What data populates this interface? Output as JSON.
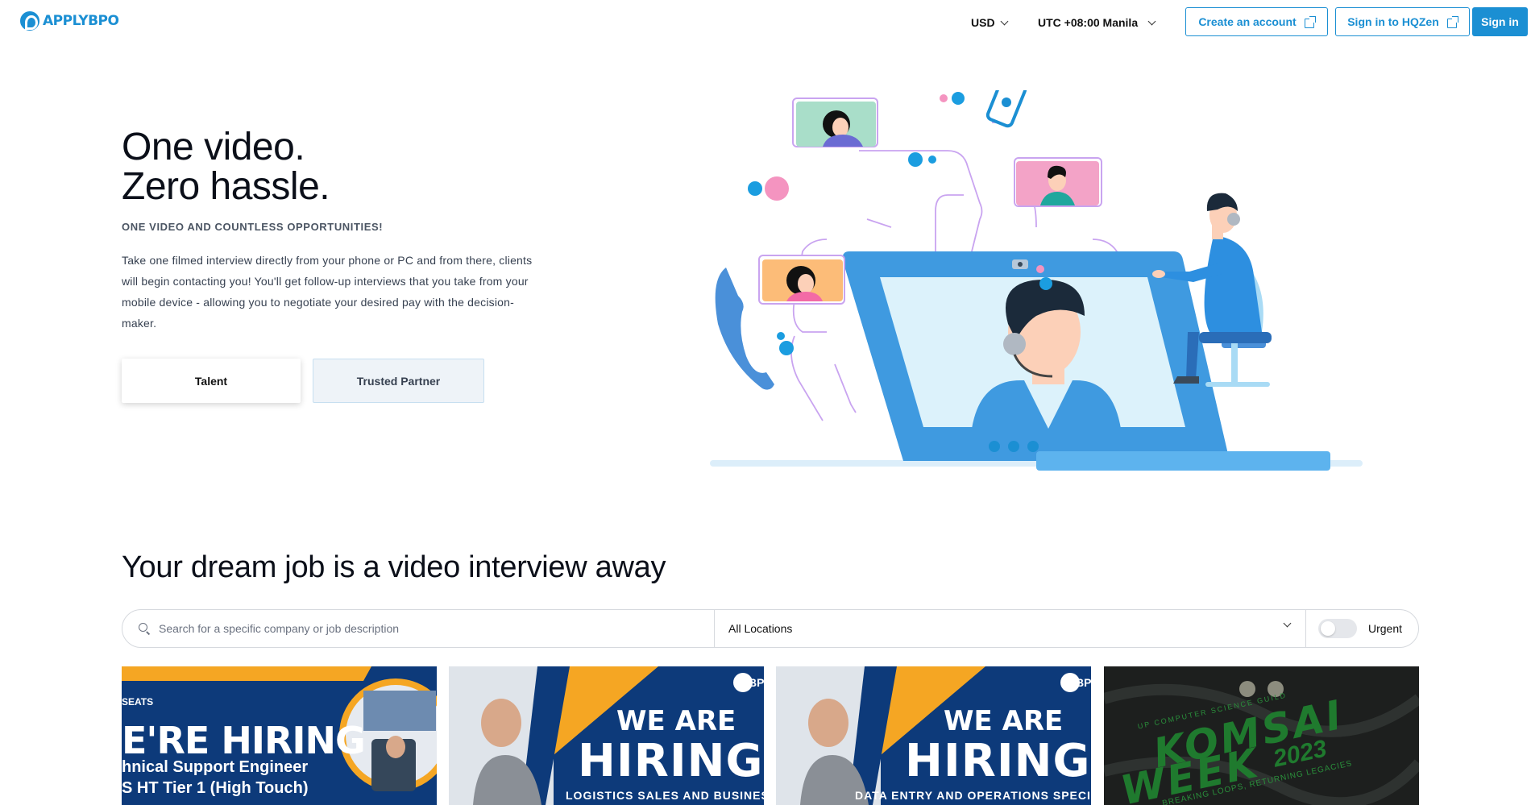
{
  "header": {
    "logo_text": "APPLYBPO",
    "currency": "USD",
    "timezone": "UTC +08:00 Manila",
    "create_account": "Create an account",
    "sign_in_hqzen": "Sign in to HQZen",
    "sign_in": "Sign in"
  },
  "hero": {
    "title_line1": "One video.",
    "title_line2": "Zero hassle.",
    "subtitle": "ONE VIDEO AND COUNTLESS OPPORTUNITIES!",
    "description": "Take one filmed interview directly from your phone or PC and from there, clients will begin contacting you! You'll get follow-up interviews that you take from your mobile device - allowing you to negotiate your desired pay with the decision-maker.",
    "talent_label": "Talent",
    "partner_label": "Trusted Partner"
  },
  "jobs": {
    "title": "Your dream job is a video interview away",
    "search_placeholder": "Search for a specific company or job description",
    "location": "All Locations",
    "urgent_label": "Urgent",
    "urgent_on": false,
    "cards": [
      {
        "tag": "SEATS",
        "headline": "E'RE HIRING",
        "line1": "hnical Support Engineer",
        "line2": "S HT Tier 1 (High Touch)"
      },
      {
        "tag": "BP",
        "headline_top": "WE ARE",
        "headline_big": "HIRING",
        "role": "LOGISTICS SALES AND BUSINES"
      },
      {
        "tag": "BP",
        "headline_top": "WE ARE",
        "headline_big": "HIRING",
        "role": "DATA ENTRY AND OPERATIONS SPECI"
      },
      {
        "headline": "KOMSAI",
        "headline2": "WEEK",
        "year": "2023",
        "top": "UP COMPUTER SCIENCE GUILD",
        "bottom": "BREAKING LOOPS, RETURNING LEGACIES"
      }
    ]
  },
  "colors": {
    "brand": "#1b8fd3",
    "navy": "#0d3a7a",
    "orange": "#f5a623"
  }
}
